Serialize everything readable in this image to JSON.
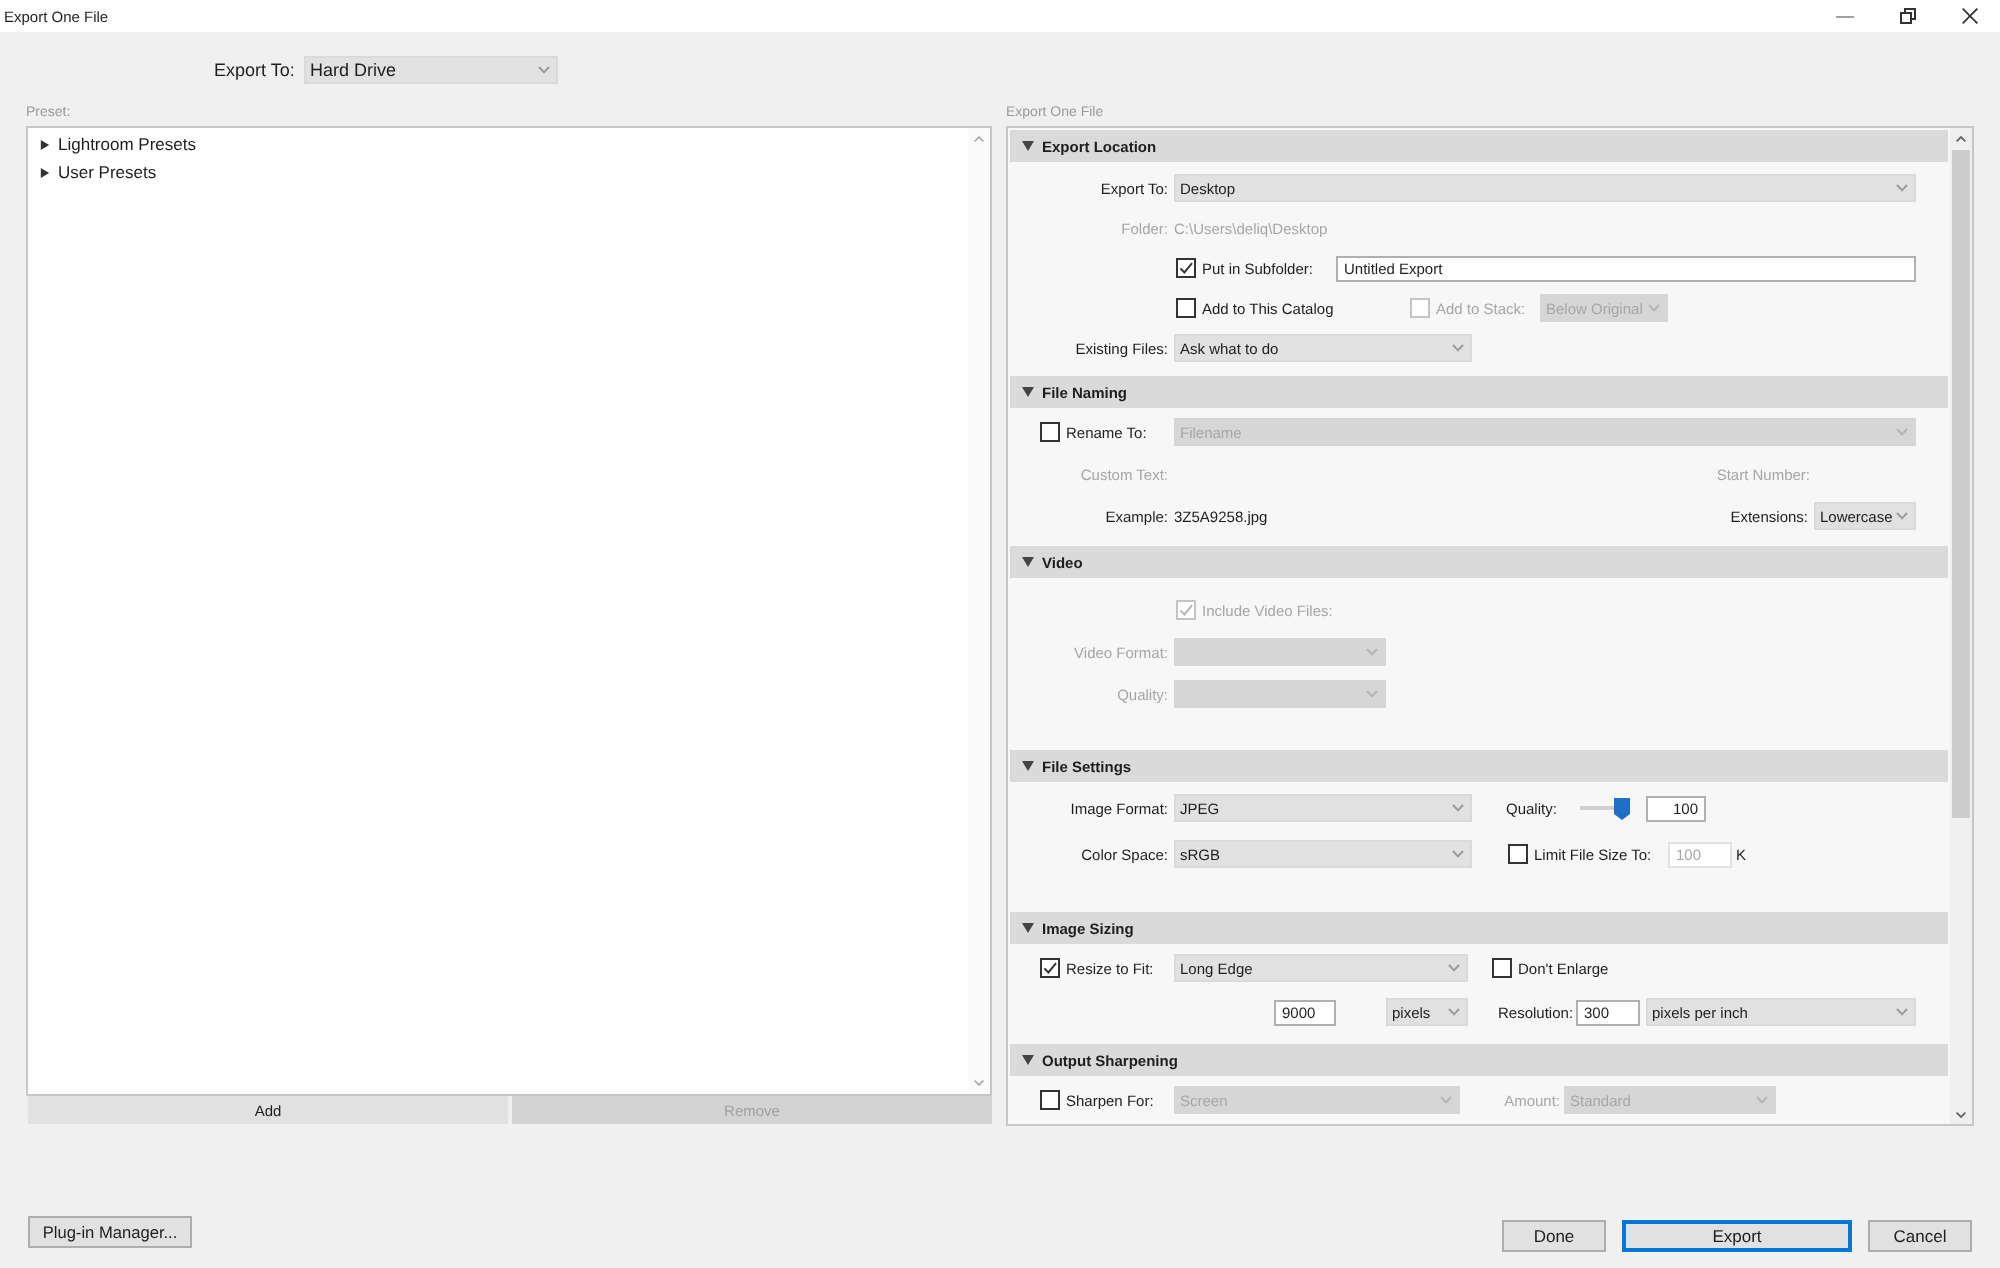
{
  "window": {
    "title": "Export One File"
  },
  "export_to": {
    "label": "Export To:",
    "value": "Hard Drive"
  },
  "presets": {
    "label": "Preset:",
    "tree": [
      {
        "label": "Lightroom Presets",
        "expanded": false
      },
      {
        "label": "User Presets",
        "expanded": false
      }
    ],
    "buttons": [
      {
        "label": "Add",
        "disabled": false
      },
      {
        "label": "Remove",
        "disabled": true
      }
    ]
  },
  "settings": {
    "label": "Export One File",
    "sections": [
      {
        "kind": "export_location",
        "title": "Export Location",
        "expanded": true,
        "export_to": {
          "label": "Export To:",
          "value": "Desktop"
        },
        "folder": {
          "label": "Folder:",
          "value": "C:\\Users\\deliq\\Desktop",
          "disabled": true
        },
        "subfolder": {
          "label": "Put in Subfolder:",
          "checked": true,
          "value": "Untitled Export"
        },
        "add_to_catalog": {
          "label": "Add to This Catalog",
          "checked": false
        },
        "add_to_stack": {
          "label": "Add to Stack:",
          "checked": false,
          "disabled": true,
          "value": "Below Original"
        },
        "existing_files": {
          "label": "Existing Files:",
          "value": "Ask what to do"
        }
      },
      {
        "kind": "file_naming",
        "title": "File Naming",
        "expanded": true,
        "rename_to": {
          "label": "Rename To:",
          "checked": false,
          "value": "Filename",
          "value_disabled": true
        },
        "custom_text": {
          "label": "Custom Text:",
          "disabled": true
        },
        "start_number": {
          "label": "Start Number:",
          "disabled": true
        },
        "example": {
          "label": "Example:",
          "value": "3Z5A9258.jpg"
        },
        "extensions": {
          "label": "Extensions:",
          "value": "Lowercase"
        }
      },
      {
        "kind": "video",
        "title": "Video",
        "expanded": true,
        "include_video": {
          "label": "Include Video Files:",
          "checked": true,
          "disabled": true
        },
        "video_format": {
          "label": "Video Format:",
          "disabled": true
        },
        "quality": {
          "label": "Quality:",
          "disabled": true
        }
      },
      {
        "kind": "file_settings",
        "title": "File Settings",
        "expanded": true,
        "image_format": {
          "label": "Image Format:",
          "value": "JPEG"
        },
        "quality": {
          "label": "Quality:",
          "level": 1,
          "value": "100"
        },
        "color_space": {
          "label": "Color Space:",
          "value": "sRGB"
        },
        "limit_size": {
          "label": "Limit File Size To:",
          "checked": false,
          "value": "100",
          "unit": "K",
          "value_disabled": true
        }
      },
      {
        "kind": "image_sizing",
        "title": "Image Sizing",
        "expanded": true,
        "resize": {
          "label": "Resize to Fit:",
          "checked": true,
          "value": "Long Edge"
        },
        "dont_enlarge": {
          "label": "Don't Enlarge",
          "checked": false
        },
        "size": {
          "value": "9000",
          "unit": "pixels"
        },
        "resolution": {
          "label": "Resolution:",
          "value": "300",
          "unit": "pixels per inch"
        }
      },
      {
        "kind": "output_sharpening",
        "title": "Output Sharpening",
        "expanded": true,
        "sharpen_for": {
          "label": "Sharpen For:",
          "checked": false,
          "value": "Screen",
          "value_disabled": true
        },
        "amount": {
          "label": "Amount:",
          "value": "Standard",
          "disabled": true
        }
      }
    ]
  },
  "footer": {
    "plugin_manager": "Plug-in Manager...",
    "buttons": [
      {
        "label": "Done",
        "default": false
      },
      {
        "label": "Export",
        "default": true
      },
      {
        "label": "Cancel",
        "default": false
      }
    ]
  }
}
